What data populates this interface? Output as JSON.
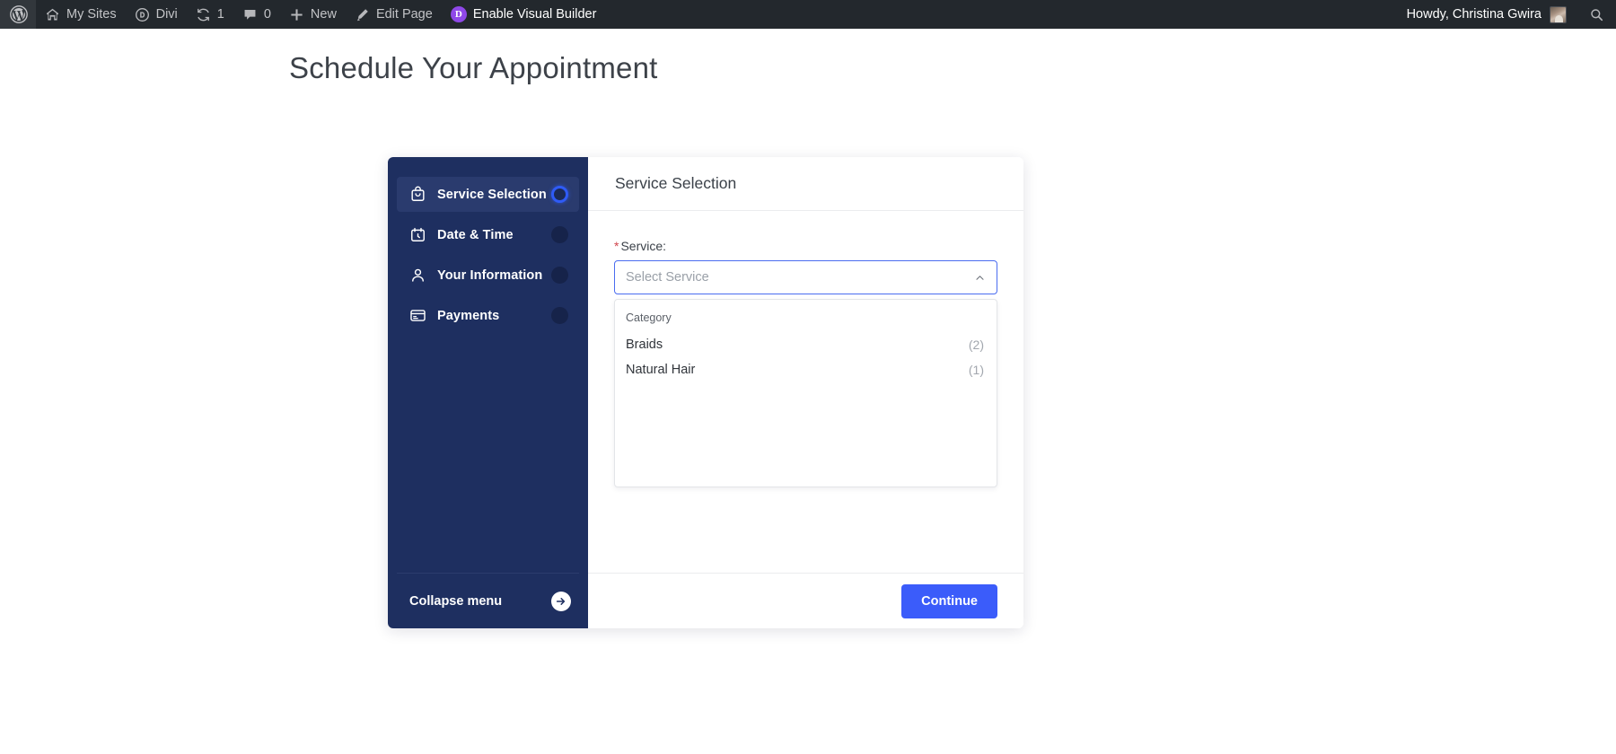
{
  "adminbar": {
    "left_items": [
      {
        "icon": "wordpress-logo-icon",
        "label": ""
      },
      {
        "icon": "my-sites-icon",
        "label": "My Sites"
      },
      {
        "icon": "divi-icon",
        "label": "Divi"
      },
      {
        "icon": "updates-icon",
        "label": "1"
      },
      {
        "icon": "comments-icon",
        "label": "0"
      },
      {
        "icon": "new-content-icon",
        "label": "New"
      },
      {
        "icon": "edit-page-icon",
        "label": "Edit Page"
      },
      {
        "icon": "divi-badge-icon",
        "label": "Enable Visual Builder"
      }
    ],
    "howdy": "Howdy, Christina Gwira",
    "search_icon": "search-icon",
    "avatar": "avatar"
  },
  "page": {
    "title": "Schedule Your Appointment"
  },
  "sidebar": {
    "steps": [
      {
        "label": "Service Selection",
        "icon": "shopping-bag-icon",
        "state": "active"
      },
      {
        "label": "Date & Time",
        "icon": "calendar-clock-icon",
        "state": "inactive"
      },
      {
        "label": "Your Information",
        "icon": "person-icon",
        "state": "inactive"
      },
      {
        "label": "Payments",
        "icon": "credit-card-icon",
        "state": "inactive"
      }
    ],
    "collapse_label": "Collapse menu",
    "collapse_icon": "arrow-right-circle-icon"
  },
  "panel": {
    "title": "Service Selection",
    "field": {
      "required_mark": "*",
      "label": "Service:",
      "placeholder": "Select Service",
      "chevron_icon": "chevron-up-icon"
    },
    "dropdown": {
      "group_title": "Category",
      "options": [
        {
          "label": "Braids",
          "count": "(2)"
        },
        {
          "label": "Natural Hair",
          "count": "(1)"
        }
      ]
    },
    "continue_label": "Continue"
  },
  "colors": {
    "adminbar_bg": "#23282d",
    "sidebar_bg": "#1e2f60",
    "sidebar_active_bg": "#2a3b6e",
    "accent_blue": "#3b5cfa",
    "active_ring": "#2f5bf6",
    "required_red": "#d0454c",
    "divi_purple": "#8f48e8"
  }
}
